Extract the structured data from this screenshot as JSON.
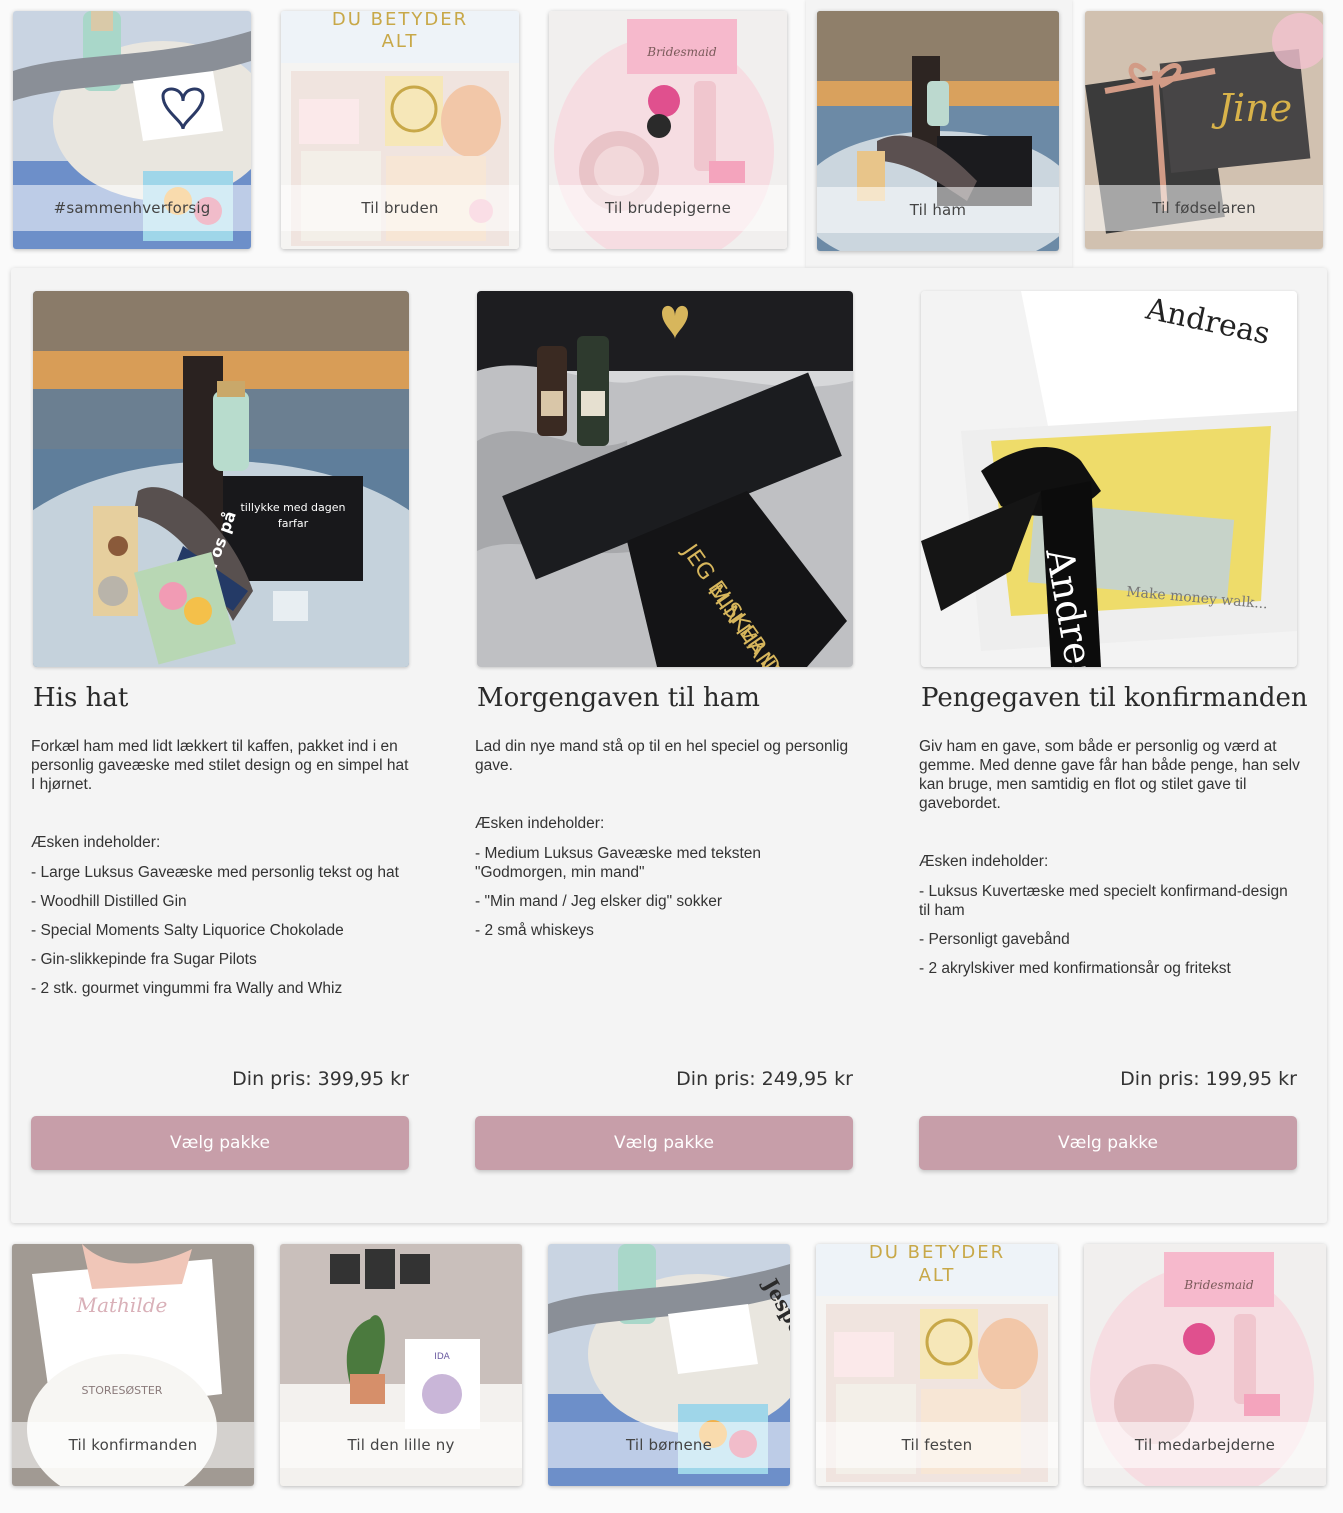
{
  "top_categories": [
    {
      "label": "#sammenhverforsig"
    },
    {
      "label": "Til bruden"
    },
    {
      "label": "Til brudepigerne"
    },
    {
      "label": "Til ham"
    },
    {
      "label": "Til fødselaren"
    }
  ],
  "products": [
    {
      "title": "His hat",
      "description": "Forkæl ham med lidt lækkert til kaffen, pakket ind i en personlig gaveæske med stilet design og en simpel hat I hjørnet.",
      "contains_label": "Æsken indeholder:",
      "items": [
        "- Large Luksus Gaveæske med personlig tekst og hat",
        "- Woodhill Distilled Gin",
        "- Special Moments Salty Liquorice Chokolade",
        "- Gin-slikkepinde fra Sugar Pilots",
        "- 2 stk. gourmet vingummi fra Wally and Whiz"
      ],
      "price": "Din pris: 399,95 kr",
      "button": "Vælg pakke"
    },
    {
      "title": "Morgengaven til ham",
      "description": "Lad din nye mand stå op til en hel speciel og personlig gave.",
      "contains_label": "Æsken indeholder:",
      "items": [
        "- Medium Luksus Gaveæske med teksten \"Godmorgen, min mand\"",
        "- \"Min mand   /   Jeg elsker dig\" sokker",
        "- 2 små whiskeys"
      ],
      "price": "Din pris: 249,95 kr",
      "button": "Vælg pakke"
    },
    {
      "title": "Pengegaven til konfirmanden",
      "description": "Giv ham en gave, som både er personlig og værd at gemme. Med denne gave får han både penge, han selv kan bruge, men samtidig en flot og stilet gave til gavebordet.",
      "contains_label": "Æsken indeholder:",
      "items": [
        "- Luksus Kuvertæske med specielt konfirmand-design til ham",
        "- Personligt gavebånd",
        "- 2 akrylskiver med konfirmationsår og fritekst"
      ],
      "price": "Din pris: 199,95 kr",
      "button": "Vælg pakke"
    }
  ],
  "bottom_categories": [
    {
      "label": "Til konfirmanden"
    },
    {
      "label": "Til den lille ny"
    },
    {
      "label": "Til børnene"
    },
    {
      "label": "Til festen"
    },
    {
      "label": "Til medarbejderne"
    }
  ],
  "image_texts": {
    "du_betyder": "DU BETYDER",
    "alt": "ALT",
    "bridesmaid": "Bridesmaid",
    "andreas": "Andreas",
    "min_mand": "MIN MAND",
    "jeg_elsker_dig": "JEG ELSKER DIG",
    "jesper": "Jesper",
    "jine": "Jine",
    "storesoster": "STORESØSTER",
    "ida": "IDA"
  },
  "colors": {
    "button": "#c79ea9",
    "panel": "#f4f4f4"
  }
}
